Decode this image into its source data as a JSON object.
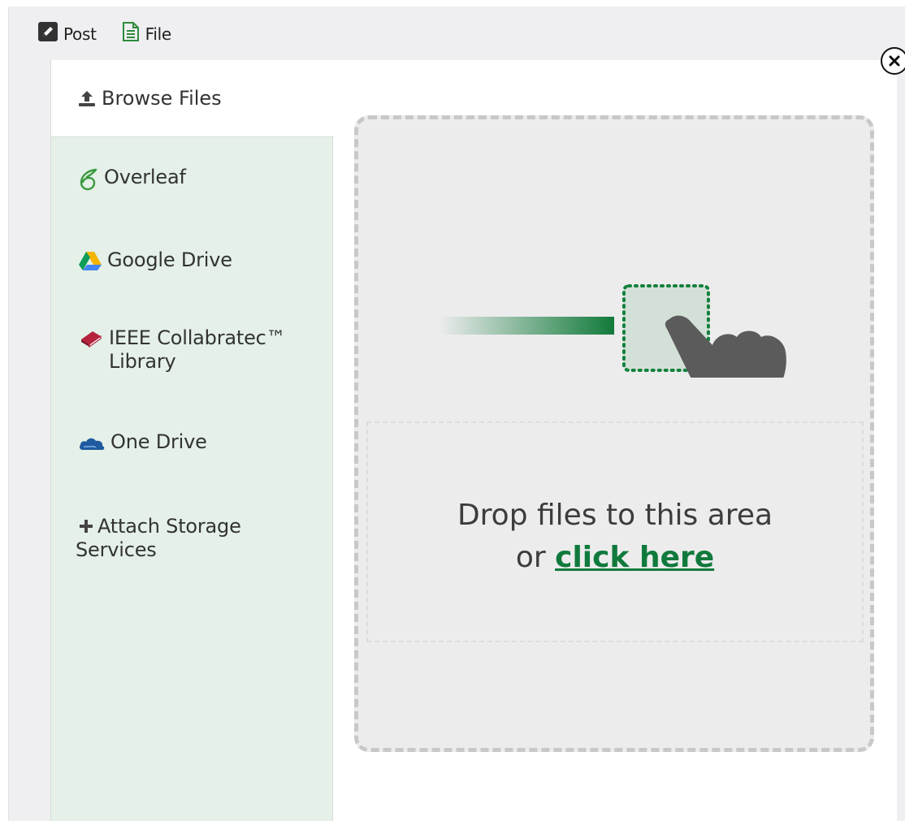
{
  "toolbar": {
    "post_label": "Post",
    "file_label": "File"
  },
  "sidebar": {
    "items": [
      {
        "label": "Browse Files",
        "icon": "upload-icon"
      },
      {
        "label": "Overleaf",
        "icon": "overleaf-icon"
      },
      {
        "label": "Google Drive",
        "icon": "google-drive-icon"
      },
      {
        "label_line1": "IEEE Collabratec™",
        "label_line2": "Library",
        "icon": "book-icon"
      },
      {
        "label": "One Drive",
        "icon": "onedrive-icon"
      },
      {
        "label_line1": "Attach Storage",
        "label_line2": "Services",
        "icon": "plus-icon"
      }
    ]
  },
  "dropzone": {
    "line1": "Drop files to this area",
    "line2_prefix": "or ",
    "link_text": "click here"
  },
  "colors": {
    "accent": "#107a3c",
    "sidebar_bg": "#e4f0e8",
    "dropzone_bg": "#ececed"
  }
}
